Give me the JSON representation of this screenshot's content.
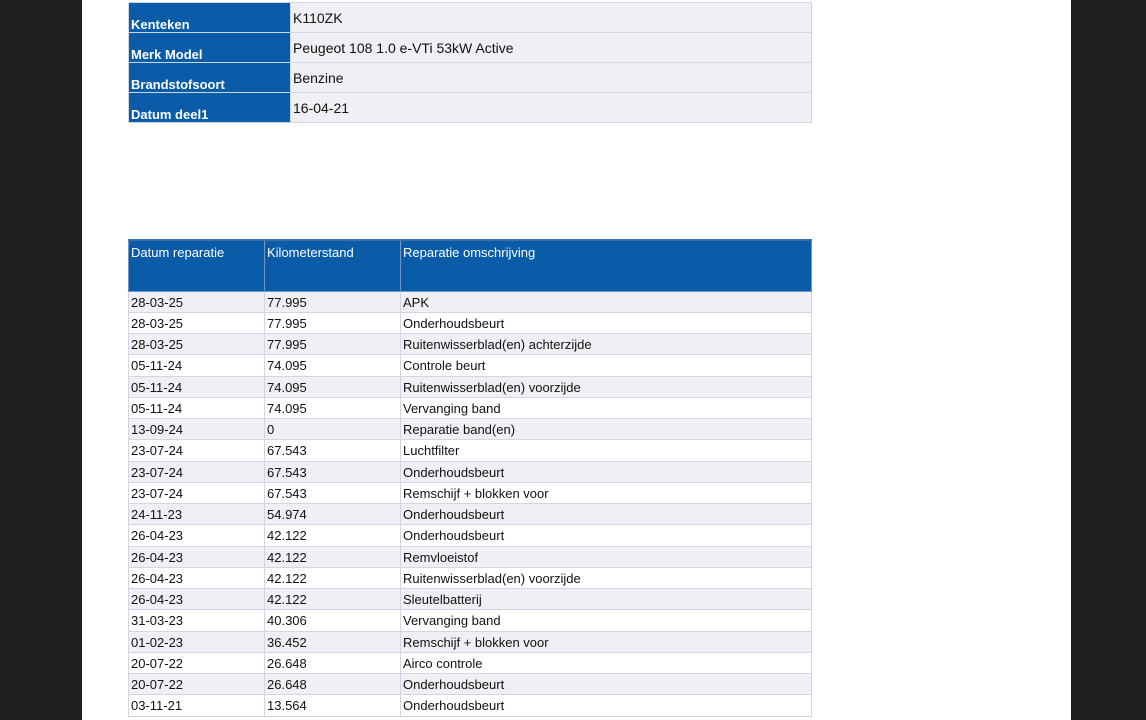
{
  "vehicle": {
    "rows": [
      {
        "label": "Kenteken",
        "value": "K110ZK"
      },
      {
        "label": "Merk Model",
        "value": "Peugeot 108 1.0 e-VTi 53kW Active"
      },
      {
        "label": "Brandstofsoort",
        "value": "Benzine"
      },
      {
        "label": "Datum deel1",
        "value": "16-04-21"
      }
    ]
  },
  "repairs": {
    "headers": [
      "Datum reparatie",
      "Kilometerstand",
      "Reparatie omschrijving"
    ],
    "rows": [
      [
        "28-03-25",
        "77.995",
        "APK"
      ],
      [
        "28-03-25",
        "77.995",
        "Onderhoudsbeurt"
      ],
      [
        "28-03-25",
        "77.995",
        "Ruitenwisserblad(en) achterzijde"
      ],
      [
        "05-11-24",
        "74.095",
        "Controle beurt"
      ],
      [
        "05-11-24",
        "74.095",
        "Ruitenwisserblad(en) voorzijde"
      ],
      [
        "05-11-24",
        "74.095",
        "Vervanging band"
      ],
      [
        "13-09-24",
        "0",
        "Reparatie band(en)"
      ],
      [
        "23-07-24",
        "67.543",
        "Luchtfilter"
      ],
      [
        "23-07-24",
        "67.543",
        "Onderhoudsbeurt"
      ],
      [
        "23-07-24",
        "67.543",
        "Remschijf + blokken voor"
      ],
      [
        "24-11-23",
        "54.974",
        "Onderhoudsbeurt"
      ],
      [
        "26-04-23",
        "42.122",
        "Onderhoudsbeurt"
      ],
      [
        "26-04-23",
        "42.122",
        "Remvloeistof"
      ],
      [
        "26-04-23",
        "42.122",
        "Ruitenwisserblad(en) voorzijde"
      ],
      [
        "26-04-23",
        "42.122",
        "Sleutelbatterij"
      ],
      [
        "31-03-23",
        "40.306",
        "Vervanging band"
      ],
      [
        "01-02-23",
        "36.452",
        "Remschijf + blokken voor"
      ],
      [
        "20-07-22",
        "26.648",
        "Airco controle"
      ],
      [
        "20-07-22",
        "26.648",
        "Onderhoudsbeurt"
      ],
      [
        "03-11-21",
        "13.564",
        "Onderhoudsbeurt"
      ]
    ]
  }
}
